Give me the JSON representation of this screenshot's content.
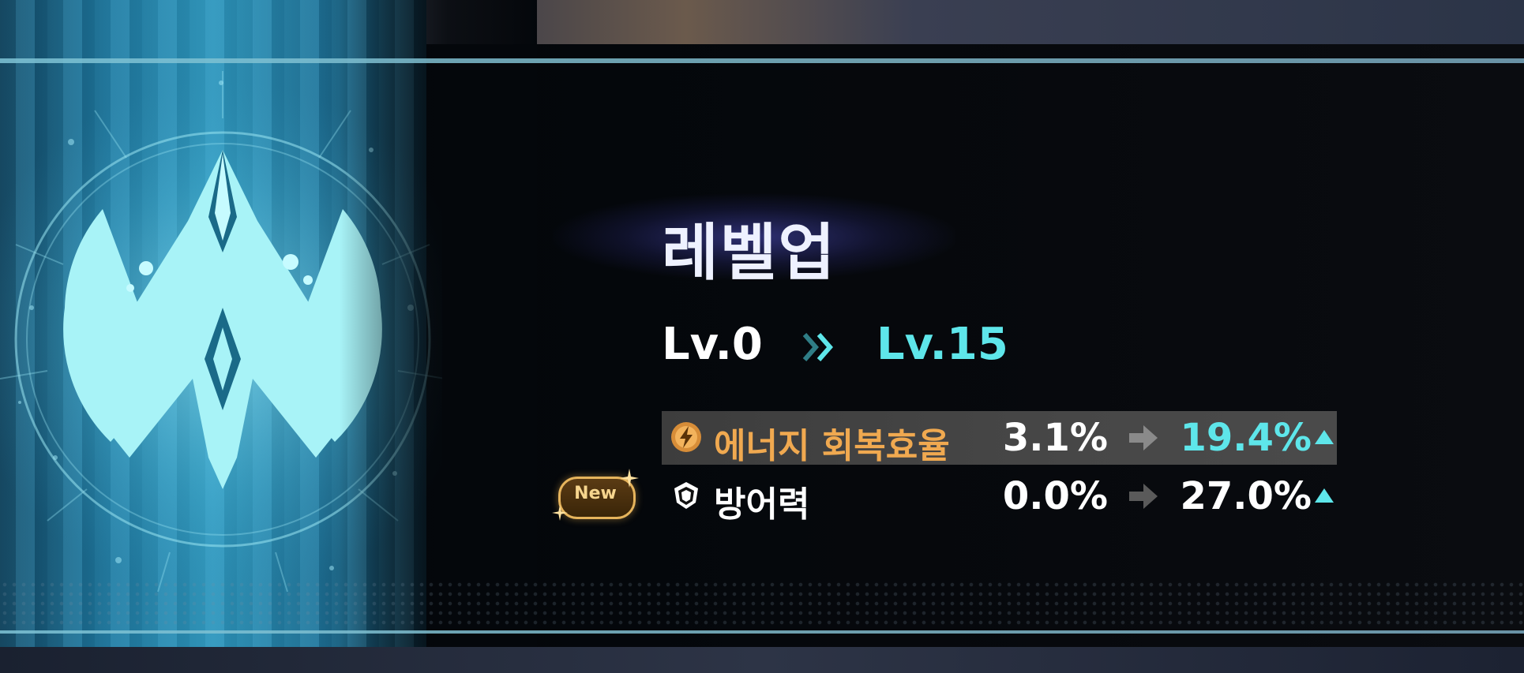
{
  "title": "레벨업",
  "level": {
    "from": "Lv.0",
    "to": "Lv.15"
  },
  "stats": [
    {
      "label": "에너지 회복효율",
      "from": "3.1%",
      "to": "19.4%",
      "icon": "energy-bolt-icon",
      "label_color": "#f0a950",
      "highlighted": true
    },
    {
      "label": "방어력",
      "from": "0.0%",
      "to": "27.0%",
      "icon": "shield-icon",
      "label_color": "#ffffff",
      "highlighted": false
    }
  ],
  "new_badge": "New",
  "colors": {
    "accent": "#5ee6ea",
    "emblem": "#a8f3f7",
    "badge_gold": "#e6b45c"
  }
}
